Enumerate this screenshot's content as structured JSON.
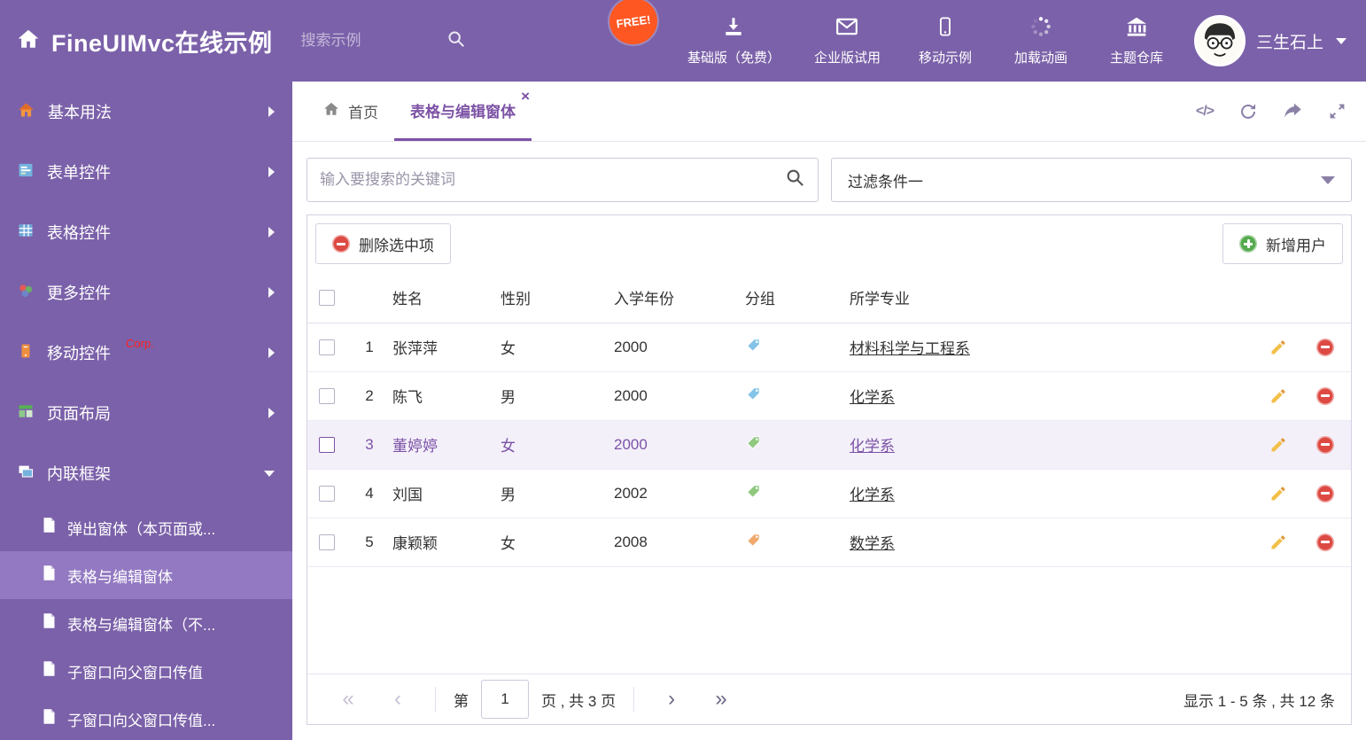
{
  "colors": {
    "accent_purple": "#7c52a5",
    "header_purple": "#7b61a9",
    "sidebar_selected": "#9379c2",
    "free_badge_red": "#ff5722",
    "delete_red": "#dd4a43",
    "add_green": "#55aa4e",
    "pencil_yellow": "#f2c04a",
    "selected_row_bg": "#f3f0fa"
  },
  "header": {
    "title": "FineUIMvc在线示例",
    "search_placeholder": "搜索示例",
    "free_badge": "FREE!",
    "nav": [
      {
        "icon": "download-icon",
        "label": "基础版（免费）"
      },
      {
        "icon": "mail-icon",
        "label": "企业版试用"
      },
      {
        "icon": "mobile-icon",
        "label": "移动示例"
      },
      {
        "icon": "spinner-icon",
        "label": "加载动画"
      },
      {
        "icon": "bank-icon",
        "label": "主题仓库"
      }
    ],
    "user": "三生石上"
  },
  "sidebar": {
    "items": [
      {
        "label": "基本用法"
      },
      {
        "label": "表单控件"
      },
      {
        "label": "表格控件"
      },
      {
        "label": "更多控件"
      },
      {
        "label": "移动控件",
        "badge": "Corp."
      },
      {
        "label": "页面布局"
      },
      {
        "label": "内联框架"
      }
    ],
    "subitems": [
      {
        "label": "弹出窗体（本页面或..."
      },
      {
        "label": "表格与编辑窗体"
      },
      {
        "label": "表格与编辑窗体（不..."
      },
      {
        "label": "子窗口向父窗口传值"
      },
      {
        "label": "子窗口向父窗口传值..."
      }
    ]
  },
  "tabs": [
    {
      "label": "首页"
    },
    {
      "label": "表格与编辑窗体"
    }
  ],
  "tab_actions": {
    "code_glyph": "</>"
  },
  "filters": {
    "search_placeholder": "输入要搜索的关键词",
    "filter_value": "过滤条件一"
  },
  "toolbar": {
    "delete_label": "删除选中项",
    "add_label": "新增用户"
  },
  "table": {
    "columns": [
      "姓名",
      "性别",
      "入学年份",
      "分组",
      "所学专业"
    ],
    "rows": [
      {
        "num": "1",
        "name": "张萍萍",
        "gender": "女",
        "year": "2000",
        "tag_color": "#85c3e8",
        "major": "材料科学与工程系"
      },
      {
        "num": "2",
        "name": "陈飞",
        "gender": "男",
        "year": "2000",
        "tag_color": "#85c3e8",
        "major": "化学系"
      },
      {
        "num": "3",
        "name": "董婷婷",
        "gender": "女",
        "year": "2000",
        "tag_color": "#8fc87e",
        "major": "化学系"
      },
      {
        "num": "4",
        "name": "刘国",
        "gender": "男",
        "year": "2002",
        "tag_color": "#8fc87e",
        "major": "化学系"
      },
      {
        "num": "5",
        "name": "康颖颖",
        "gender": "女",
        "year": "2008",
        "tag_color": "#f0a96b",
        "major": "数学系"
      }
    ]
  },
  "pagination": {
    "first_icon": "«",
    "prev_icon": "‹",
    "next_icon": "›",
    "last_icon": "»",
    "page_prefix": "第",
    "page_value": "1",
    "page_suffix": "页 , 共 3 页",
    "summary": "显示 1 - 5 条 , 共 12 条"
  }
}
